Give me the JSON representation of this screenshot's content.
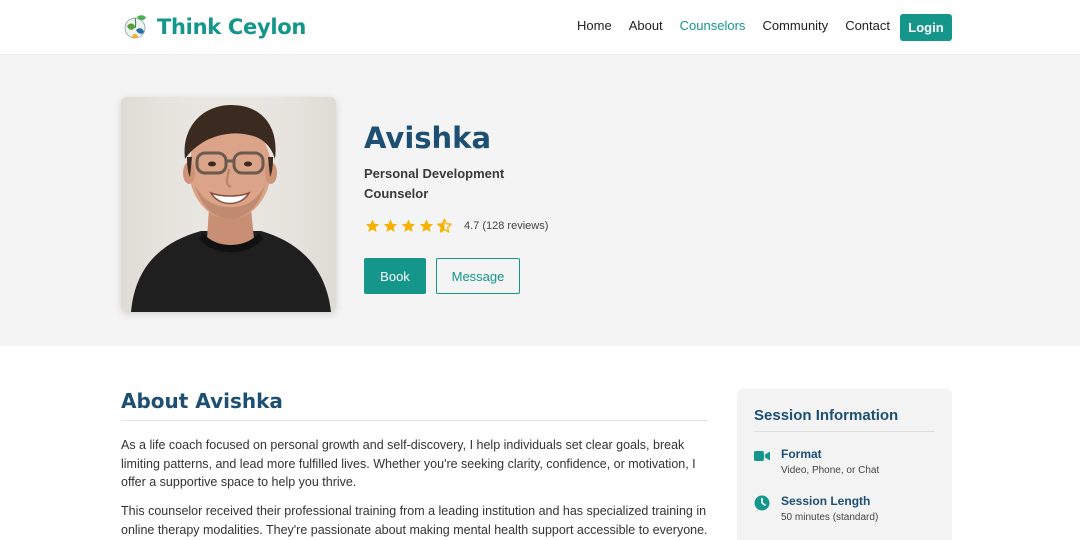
{
  "app": {
    "brand_name": "Think Ceylon",
    "logo_icon": "globe-leaf-icon",
    "accent_color": "#14968b",
    "heading_color": "#1d4f73"
  },
  "nav": {
    "items": [
      {
        "label": "Home",
        "active": false
      },
      {
        "label": "About",
        "active": false
      },
      {
        "label": "Counselors",
        "active": true
      },
      {
        "label": "Community",
        "active": false
      },
      {
        "label": "Contact",
        "active": false
      }
    ],
    "login_label": "Login"
  },
  "profile": {
    "name": "Avishka",
    "role": "Personal Development Counselor",
    "rating_value": 4.7,
    "stars_display": 4.5,
    "rating_text": "4.7 (128 reviews)",
    "star_color": "#f5b301",
    "book_label": "Book",
    "message_label": "Message"
  },
  "about": {
    "title": "About Avishka",
    "paragraphs": [
      "As a life coach focused on personal growth and self-discovery, I help individuals set clear goals, break limiting patterns, and lead more fulfilled lives. Whether you're seeking clarity, confidence, or motivation, I offer a supportive space to help you thrive.",
      "This counselor received their professional training from a leading institution and has specialized training in online therapy modalities. They're passionate about making mental health support accessible to everyone."
    ]
  },
  "session": {
    "title": "Session Information",
    "items": [
      {
        "icon": "video-camera-icon",
        "label": "Format",
        "value": "Video, Phone, or Chat"
      },
      {
        "icon": "clock-icon",
        "label": "Session Length",
        "value": "50 minutes (standard)"
      }
    ]
  }
}
